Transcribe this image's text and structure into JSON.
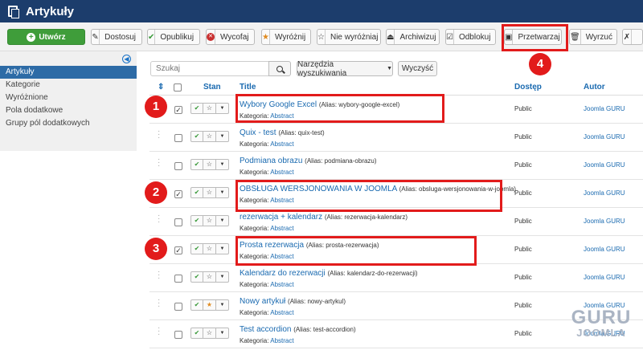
{
  "header": {
    "title": "Artykuły"
  },
  "toolbar": {
    "create": "Utwórz",
    "buttons": [
      {
        "label": "Dostosuj",
        "icon": "edit-icon"
      },
      {
        "label": "Opublikuj",
        "icon": "check-icon"
      },
      {
        "label": "Wycofaj",
        "icon": "unpublish-icon"
      },
      {
        "label": "Wyróżnij",
        "icon": "star-icon"
      },
      {
        "label": "Nie wyróżniaj",
        "icon": "star-outline-icon"
      },
      {
        "label": "Archiwizuj",
        "icon": "archive-icon"
      },
      {
        "label": "Odblokuj",
        "icon": "checkin-icon"
      },
      {
        "label": "Przetwarzaj",
        "icon": "batch-icon"
      },
      {
        "label": "Wyrzuć",
        "icon": "trash-icon"
      }
    ]
  },
  "sidebar": {
    "items": [
      {
        "label": "Artykuły",
        "active": true
      },
      {
        "label": "Kategorie",
        "active": false
      },
      {
        "label": "Wyróżnione",
        "active": false
      },
      {
        "label": "Pola dodatkowe",
        "active": false
      },
      {
        "label": "Grupy pól dodatkowych",
        "active": false
      }
    ]
  },
  "filters": {
    "search_placeholder": "Szukaj",
    "tools_label": "Narzędzia wyszukiwania",
    "clear_label": "Wyczyść"
  },
  "table": {
    "headers": {
      "status": "Stan",
      "title": "Title",
      "access": "Dostęp",
      "author": "Autor"
    },
    "category_prefix": "Kategoria:",
    "rows": [
      {
        "title": "Wybory Google Excel",
        "alias": "(Alias: wybory-google-excel)",
        "category": "Abstract",
        "access": "Public",
        "author": "Joomla GURU",
        "checked": true,
        "featured": false
      },
      {
        "title": "Quix - test",
        "alias": "(Alias: quix-test)",
        "category": "Abstract",
        "access": "Public",
        "author": "Joomla GURU",
        "checked": false,
        "featured": false
      },
      {
        "title": "Podmiana obrazu",
        "alias": "(Alias: podmiana-obrazu)",
        "category": "Abstract",
        "access": "Public",
        "author": "Joomla GURU",
        "checked": false,
        "featured": false
      },
      {
        "title": "OBSŁUGA WERSJONOWANIA W JOOMLA",
        "alias": "(Alias: obsluga-wersjonowania-w-joomla)",
        "category": "Abstract",
        "access": "Public",
        "author": "Joomla GURU",
        "checked": true,
        "featured": false
      },
      {
        "title": "rezerwacja + kalendarz",
        "alias": "(Alias: rezerwacja-kalendarz)",
        "category": "Abstract",
        "access": "Public",
        "author": "Joomla GURU",
        "checked": false,
        "featured": false
      },
      {
        "title": "Prosta rezerwacja",
        "alias": "(Alias: prosta-rezerwacja)",
        "category": "Abstract",
        "access": "Public",
        "author": "Joomla GURU",
        "checked": true,
        "featured": false
      },
      {
        "title": "Kalendarz do rezerwacji",
        "alias": "(Alias: kalendarz-do-rezerwacji)",
        "category": "Abstract",
        "access": "Public",
        "author": "Joomla GURU",
        "checked": false,
        "featured": false
      },
      {
        "title": "Nowy artykuł",
        "alias": "(Alias: nowy-artykul)",
        "category": "Abstract",
        "access": "Public",
        "author": "Joomla GURU",
        "checked": false,
        "featured": true
      },
      {
        "title": "Test accordion",
        "alias": "(Alias: test-accordion)",
        "category": "Abstract",
        "access": "Public",
        "author": "Joomla GURU",
        "checked": false,
        "featured": false
      }
    ]
  },
  "annotations": {
    "numbers": [
      "1",
      "2",
      "3",
      "4"
    ],
    "color": "#e21b1b"
  },
  "watermark": {
    "line1": "GURU",
    "line2": "JOOMLA"
  },
  "colors": {
    "header_bg": "#1c3d6c",
    "create_green": "#3f9d3a",
    "link_blue": "#1a6ab0",
    "sidebar_active": "#2d6ba6"
  }
}
